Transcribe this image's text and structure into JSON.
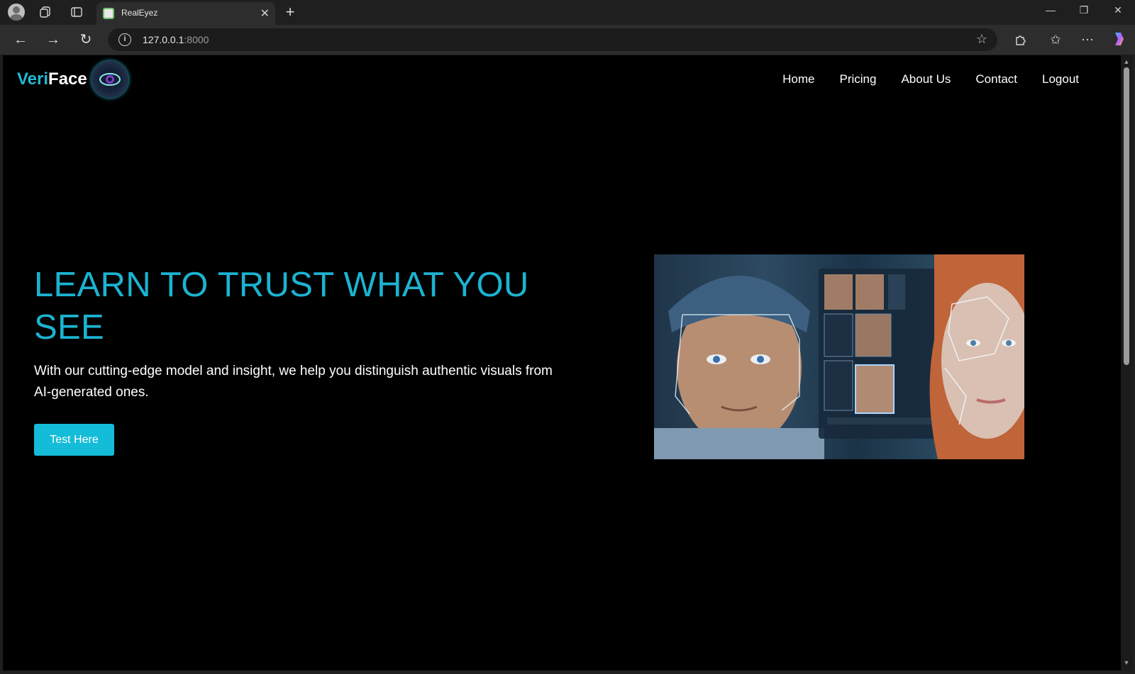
{
  "browser": {
    "tab_title": "RealEyez",
    "url_host": "127.0.0.1",
    "url_port": ":8000"
  },
  "site": {
    "logo": {
      "part1": "Veri",
      "part2": "Face"
    },
    "nav": [
      "Home",
      "Pricing",
      "About Us",
      "Contact",
      "Logout"
    ],
    "hero": {
      "title": "LEARN TO TRUST WHAT YOU SEE",
      "subtitle": "With our cutting-edge model and insight, we help you distinguish authentic visuals from AI-generated ones.",
      "cta_label": "Test Here"
    }
  },
  "colors": {
    "accent": "#1cb3d1",
    "button": "#14bcd8",
    "background": "#000000"
  },
  "icons": [
    "profile-icon",
    "workspaces-icon",
    "tab-actions-icon",
    "favicon",
    "close-icon",
    "new-tab-icon",
    "minimize-icon",
    "restore-icon",
    "window-close-icon",
    "back-icon",
    "forward-icon",
    "refresh-icon",
    "info-icon",
    "favorite-star-icon",
    "extensions-icon",
    "favorites-icon",
    "more-icon",
    "copilot-icon",
    "eye-logo-icon"
  ]
}
